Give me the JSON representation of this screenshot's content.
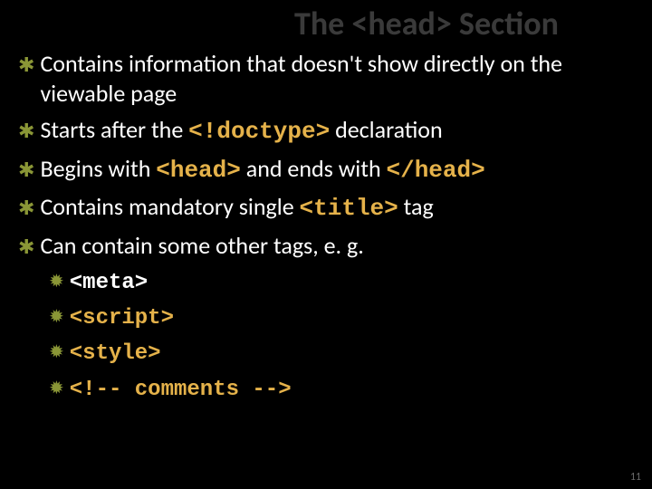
{
  "title": "The <head> Section",
  "bullets": [
    {
      "parts": [
        {
          "t": "plain",
          "v": "Contains information that doesn't show directly on the viewable page"
        }
      ]
    },
    {
      "parts": [
        {
          "t": "plain",
          "v": "Starts after the "
        },
        {
          "t": "code",
          "v": "<!doctype>"
        },
        {
          "t": "plain",
          "v": " declaration"
        }
      ]
    },
    {
      "parts": [
        {
          "t": "plain",
          "v": "Begins with "
        },
        {
          "t": "code",
          "v": "<head>"
        },
        {
          "t": "plain",
          "v": " and ends with "
        },
        {
          "t": "code",
          "v": "</head>"
        }
      ]
    },
    {
      "parts": [
        {
          "t": "plain",
          "v": "Contains mandatory single "
        },
        {
          "t": "code",
          "v": "<title>"
        },
        {
          "t": "plain",
          "v": " tag"
        }
      ]
    },
    {
      "parts": [
        {
          "t": "plain",
          "v": "Can contain some other tags, e. g."
        }
      ]
    }
  ],
  "sub_bullets": [
    {
      "parts": [
        {
          "t": "codew",
          "v": "<meta>"
        }
      ]
    },
    {
      "parts": [
        {
          "t": "code",
          "v": "<script>"
        }
      ]
    },
    {
      "parts": [
        {
          "t": "code",
          "v": "<style>"
        }
      ]
    },
    {
      "parts": [
        {
          "t": "code",
          "v": "<!-- comments -->"
        }
      ]
    }
  ],
  "page_number": "11",
  "icons": {
    "main": "✱",
    "sub": "✹"
  }
}
